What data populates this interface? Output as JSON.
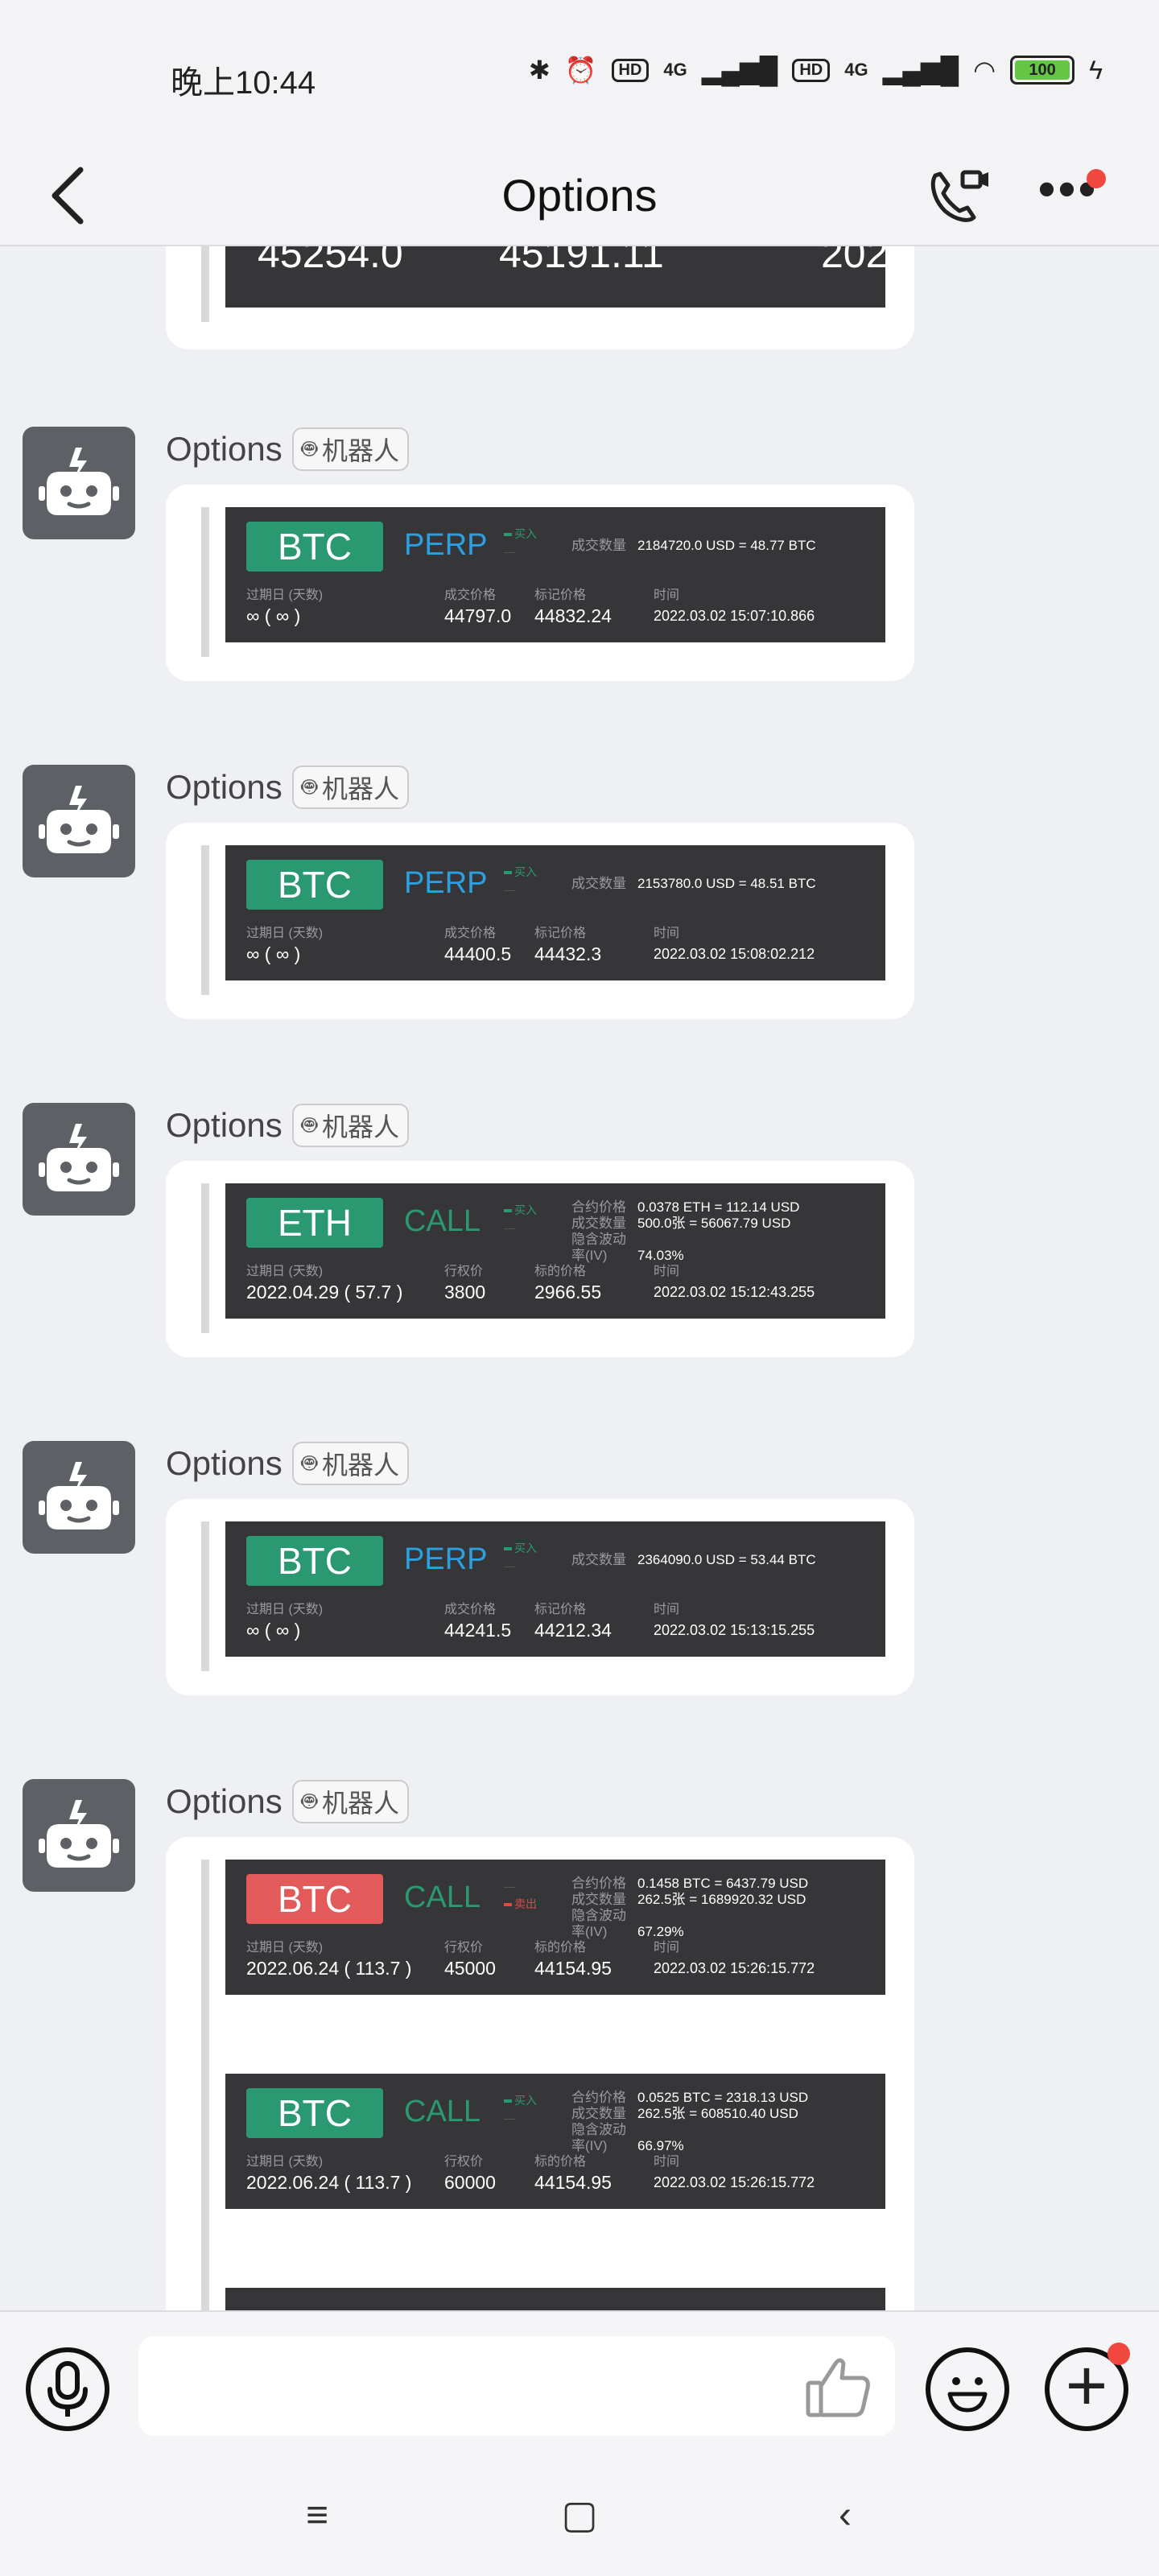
{
  "status": {
    "time": "晚上10:44",
    "hd1": "HD",
    "net1": "4G",
    "hd2": "HD",
    "net2": "4G",
    "battery": "100"
  },
  "header": {
    "title": "Options"
  },
  "top_partial": {
    "v1": "45254.0",
    "v2": "45191.11",
    "v3": "202"
  },
  "messages": [
    {
      "sender": "Options",
      "badge": "机器人",
      "symbol": "BTC",
      "kind": "PERP",
      "side": "买入",
      "info_label": "成交数量",
      "info_value": "2184720.0 USD = 48.77 BTC",
      "exp_label": "过期日 (天数)",
      "exp_value": "∞ ( ∞ )",
      "c2_label": "成交价格",
      "c2_value": "44797.0",
      "c3_label": "标记价格",
      "c3_value": "44832.24",
      "time_label": "时间",
      "time_value": "2022.03.02 15:07:10.866"
    },
    {
      "sender": "Options",
      "badge": "机器人",
      "symbol": "BTC",
      "kind": "PERP",
      "side": "买入",
      "info_label": "成交数量",
      "info_value": "2153780.0 USD = 48.51 BTC",
      "exp_label": "过期日 (天数)",
      "exp_value": "∞ ( ∞ )",
      "c2_label": "成交价格",
      "c2_value": "44400.5",
      "c3_label": "标记价格",
      "c3_value": "44432.3",
      "time_label": "时间",
      "time_value": "2022.03.02 15:08:02.212"
    },
    {
      "sender": "Options",
      "badge": "机器人",
      "symbol": "ETH",
      "kind": "CALL",
      "side": "买入",
      "info1_label": "合约价格",
      "info1_value": "0.0378 ETH = 112.14 USD",
      "info2_label": "成交数量",
      "info2_value": "500.0张 = 56067.79 USD",
      "info3_label": "隐含波动率(IV)",
      "info3_value": "74.03%",
      "exp_label": "过期日 (天数)",
      "exp_value": "2022.04.29 ( 57.7 )",
      "c2_label": "行权价",
      "c2_value": "3800",
      "c3_label": "标的价格",
      "c3_value": "2966.55",
      "time_label": "时间",
      "time_value": "2022.03.02 15:12:43.255"
    },
    {
      "sender": "Options",
      "badge": "机器人",
      "symbol": "BTC",
      "kind": "PERP",
      "side": "买入",
      "info_label": "成交数量",
      "info_value": "2364090.0 USD = 53.44 BTC",
      "exp_label": "过期日 (天数)",
      "exp_value": "∞ ( ∞ )",
      "c2_label": "成交价格",
      "c2_value": "44241.5",
      "c3_label": "标记价格",
      "c3_value": "44212.34",
      "time_label": "时间",
      "time_value": "2022.03.02 15:13:15.255"
    },
    {
      "sender": "Options",
      "badge": "机器人",
      "cards": [
        {
          "symbol": "BTC",
          "kind": "CALL",
          "side": "卖出",
          "info1_label": "合约价格",
          "info1_value": "0.1458 BTC = 6437.79 USD",
          "info2_label": "成交数量",
          "info2_value": "262.5张 = 1689920.32 USD",
          "info3_label": "隐含波动率(IV)",
          "info3_value": "67.29%",
          "exp_label": "过期日 (天数)",
          "exp_value": "2022.06.24 ( 113.7 )",
          "c2_label": "行权价",
          "c2_value": "45000",
          "c3_label": "标的价格",
          "c3_value": "44154.95",
          "time_label": "时间",
          "time_value": "2022.03.02 15:26:15.772"
        },
        {
          "symbol": "BTC",
          "kind": "CALL",
          "side": "买入",
          "info1_label": "合约价格",
          "info1_value": "0.0525 BTC = 2318.13 USD",
          "info2_label": "成交数量",
          "info2_value": "262.5张 = 608510.40 USD",
          "info3_label": "隐含波动率(IV)",
          "info3_value": "66.97%",
          "exp_label": "过期日 (天数)",
          "exp_value": "2022.06.24 ( 113.7 )",
          "c2_label": "行权价",
          "c2_value": "60000",
          "c3_label": "标的价格",
          "c3_value": "44154.95",
          "time_label": "时间",
          "time_value": "2022.03.02 15:26:15.772"
        }
      ]
    }
  ],
  "colors": {
    "buy_green": "#2a9871",
    "sell_red": "#e25a5a",
    "perp_blue": "#2ba0e0",
    "card_bg": "#363639"
  },
  "icons": {
    "back": "chevron-left-icon",
    "call": "video-call-icon",
    "more": "more-dots-icon",
    "mic": "microphone-icon",
    "like": "thumbs-up-icon",
    "emoji": "emoji-icon",
    "plus": "plus-icon"
  }
}
